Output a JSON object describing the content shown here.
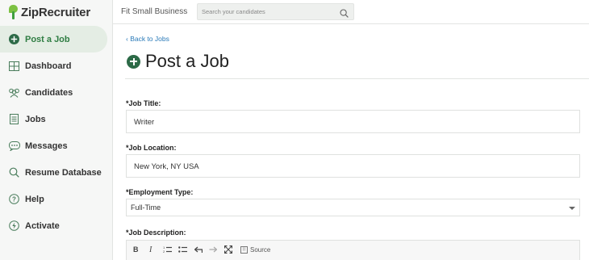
{
  "app": {
    "logo_text": "ZipRecruiter",
    "brand_color": "#2f7d43"
  },
  "sidebar": {
    "items": [
      {
        "label": "Post a Job",
        "icon": "plus-circle-icon",
        "active": true
      },
      {
        "label": "Dashboard",
        "icon": "dashboard-icon"
      },
      {
        "label": "Candidates",
        "icon": "people-icon"
      },
      {
        "label": "Jobs",
        "icon": "document-icon"
      },
      {
        "label": "Messages",
        "icon": "chat-bubble-icon"
      },
      {
        "label": "Resume Database",
        "icon": "search-icon"
      },
      {
        "label": "Help",
        "icon": "help-icon"
      },
      {
        "label": "Activate",
        "icon": "activate-icon"
      }
    ]
  },
  "topbar": {
    "company": "Fit Small Business",
    "search_placeholder": "Search your candidates"
  },
  "main": {
    "back_link": "‹ Back to Jobs",
    "title": "Post a Job",
    "job_title_label": "*Job Title:",
    "job_title_value": "Writer",
    "job_location_label": "*Job Location:",
    "job_location_value": "New York, NY USA",
    "employment_type_label": "*Employment Type:",
    "employment_type_value": "Full-Time",
    "job_description_label": "*Job Description:",
    "editor_toolbar": {
      "bold": "B",
      "italic": "I",
      "source": "Source"
    }
  }
}
